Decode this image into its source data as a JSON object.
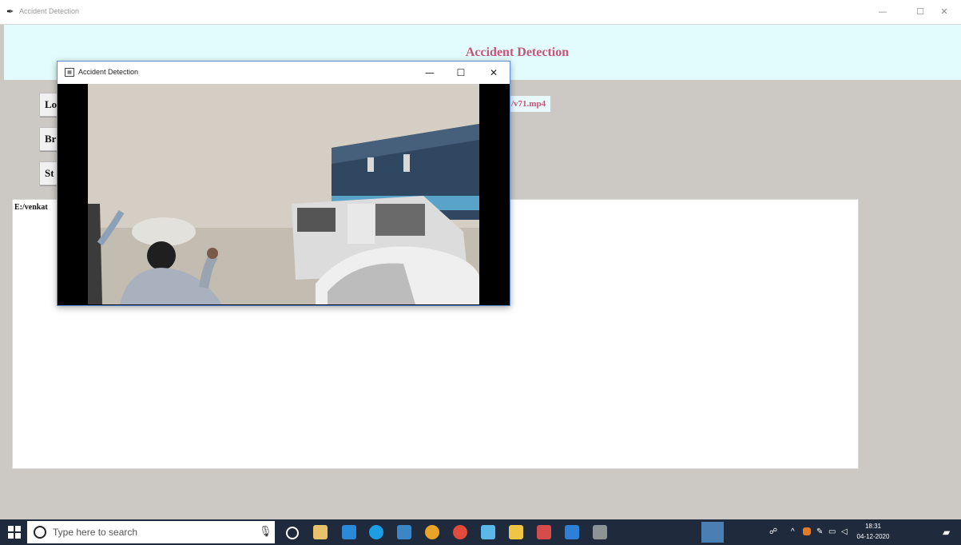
{
  "main_window": {
    "title": "Accident Detection",
    "minimize": "—",
    "maximize": "☐",
    "close": "✕"
  },
  "banner": {
    "heading": "Accident Detection"
  },
  "buttons": [
    {
      "label": "Lo"
    },
    {
      "label": "Br"
    },
    {
      "label": "St"
    }
  ],
  "file_path_label": "/v71.mp4",
  "output_text": "E:/venkat",
  "popup": {
    "title": "Accident Detection",
    "minimize": "—",
    "maximize": "☐",
    "close": "✕"
  },
  "taskbar": {
    "search_placeholder": "Type here to search",
    "time": "18:31",
    "date": "04-12-2020"
  }
}
